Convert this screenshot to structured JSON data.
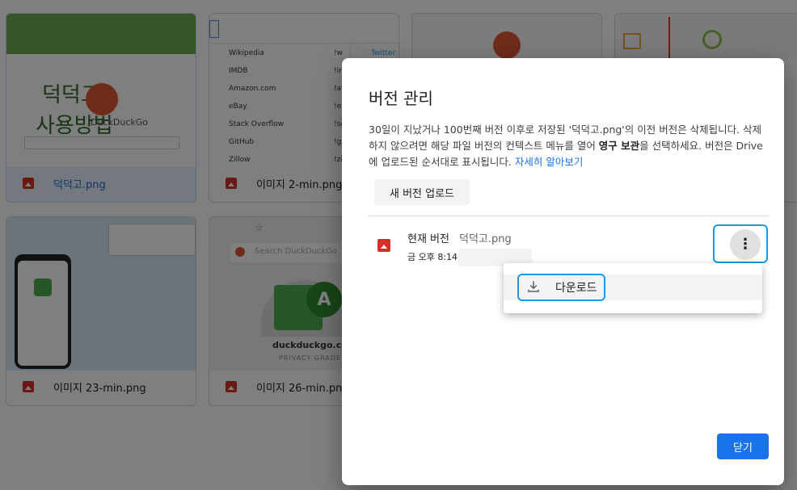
{
  "files": [
    {
      "name": "덕덕고.png",
      "selected": true
    },
    {
      "name": "이미지 2-min.png",
      "selected": false
    },
    {
      "name": "",
      "selected": false
    },
    {
      "name": "",
      "selected": false
    },
    {
      "name": "이미지 23-min.png",
      "selected": false
    },
    {
      "name": "이미지 26-min.png",
      "selected": false
    }
  ],
  "thumb1": {
    "title_line1": "덕덕고",
    "title_line2": "사용방법",
    "logo_text": "DuckDuckGo"
  },
  "thumb2": {
    "rows": [
      {
        "label": "Wikipedia",
        "right": "!w"
      },
      {
        "label": "IMDB",
        "right": "!imdb"
      },
      {
        "label": "Amazon.com",
        "right": "!a"
      },
      {
        "label": "eBay",
        "right": "!e"
      },
      {
        "label": "Stack Overflow",
        "right": "!so"
      },
      {
        "label": "GitHub",
        "right": "!gh"
      },
      {
        "label": "Zillow",
        "right": "!zillow"
      }
    ],
    "side_label": "Twitter"
  },
  "thumb6": {
    "search_placeholder": "Search DuckDuckGo",
    "avatar_letter": "A",
    "domain": "duckduckgo.com",
    "grade_label": "PRIVACY GRADE"
  },
  "dialog": {
    "title": "버전 관리",
    "desc_part1": "30일이 지났거나 100번째 버전 이후로 저장된 '덕덕고.png'의 이전 버전은 삭제됩니다. 삭제하지 않으려면 해당 파일 버전의 컨텍스트 메뉴를 열어 ",
    "desc_bold": "영구 보관",
    "desc_part2": "을 선택하세요. 버전은 Drive에 업로드된 순서대로 표시됩니다. ",
    "desc_link": "자세히 알아보기",
    "upload_button": "새 버전 업로드",
    "version": {
      "label": "현재 버전",
      "filename": "덕덕고.png",
      "time": "금 오후 8:14"
    },
    "menu": {
      "download_label": "다운로드"
    },
    "close_button": "닫기"
  },
  "colors": {
    "accent": "#1a73e8",
    "highlight": "#1a9be0",
    "file_icon": "#d93025"
  }
}
